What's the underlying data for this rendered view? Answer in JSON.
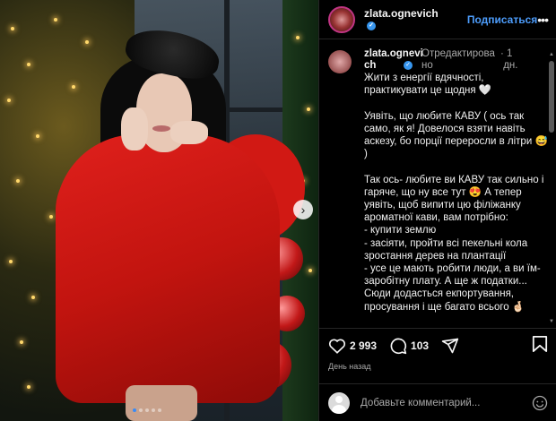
{
  "post": {
    "username": "zlata.ognevich",
    "verified": true,
    "follow_label": "Подписаться",
    "more_label": "•••",
    "next_label": "›",
    "carousel": {
      "count": 5,
      "active_index": 0
    }
  },
  "caption": {
    "username_wrapped": "zlata.ognevi\nch",
    "edited_label": "Отредактирова\nно",
    "time_label": "· 1\n дн.",
    "text": "Жити з енергії вдячності, практикувати це щодня 🤍\n\nУявіть, що любите КАВУ ( ось так само, як я! Довелося взяти навіть аскезу, бо порції переросли в літри 😅 )\n\nТак ось- любите ви КАВУ так сильно і гаряче, що ну все тут 😍 А тепер уявіть, щоб випити цю філіжанку ароматної кави, вам потрібно:\n- купити землю\n- засіяти, пройти всі пекельні кола зростання дерев на плантації\n- усе це мають робити люди, а ви їм- заробітну плату. А ще ж податки...\nСюди додасться екпортування, просування і ще багато всього 🤞🏻"
  },
  "actions": {
    "likes": "2 993",
    "comments": "103",
    "posted": "День назад"
  },
  "comment": {
    "placeholder": "Добавьте комментарий..."
  },
  "colors": {
    "accent": "#4d9dfc",
    "verified": "#3897f0",
    "background": "#000000",
    "divider": "#262626",
    "muted": "#a8a8a8"
  }
}
